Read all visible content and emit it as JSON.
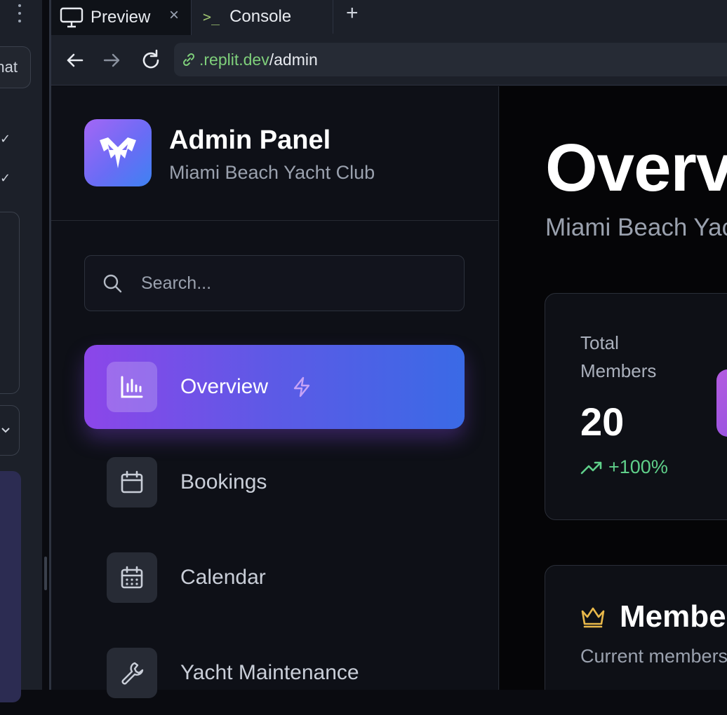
{
  "workspace": {
    "chat_label": "hat",
    "check_glyph": "✓"
  },
  "browser": {
    "tabs": [
      {
        "label": "Preview",
        "icon": "monitor-icon",
        "active": true
      },
      {
        "label": "Console",
        "icon": "terminal-icon",
        "active": false
      }
    ],
    "console_prompt": ">_",
    "close_glyph": "×",
    "add_glyph": "+",
    "url_host": ".replit.dev",
    "url_path": "/admin"
  },
  "sidebar": {
    "brand_title": "Admin Panel",
    "brand_subtitle": "Miami Beach Yacht Club",
    "search_placeholder": "Search...",
    "items": [
      {
        "label": "Overview",
        "icon": "bar-chart-icon",
        "active": true
      },
      {
        "label": "Bookings",
        "icon": "calendar-icon",
        "active": false
      },
      {
        "label": "Calendar",
        "icon": "calendar-grid-icon",
        "active": false
      },
      {
        "label": "Yacht Maintenance",
        "icon": "wrench-icon",
        "active": false
      }
    ]
  },
  "main": {
    "title": "Overview",
    "subtitle": "Miami Beach Yacht Club",
    "stat": {
      "label": "Total Members",
      "value": "20",
      "trend": "+100%"
    },
    "members": {
      "title": "Members",
      "subtitle": "Current members"
    }
  },
  "colors": {
    "accent_start": "#8c46e9",
    "accent_end": "#3a6ae6",
    "trend_positive": "#5fd08a",
    "crown": "#e8b84a",
    "url_host": "#7fd07b"
  }
}
